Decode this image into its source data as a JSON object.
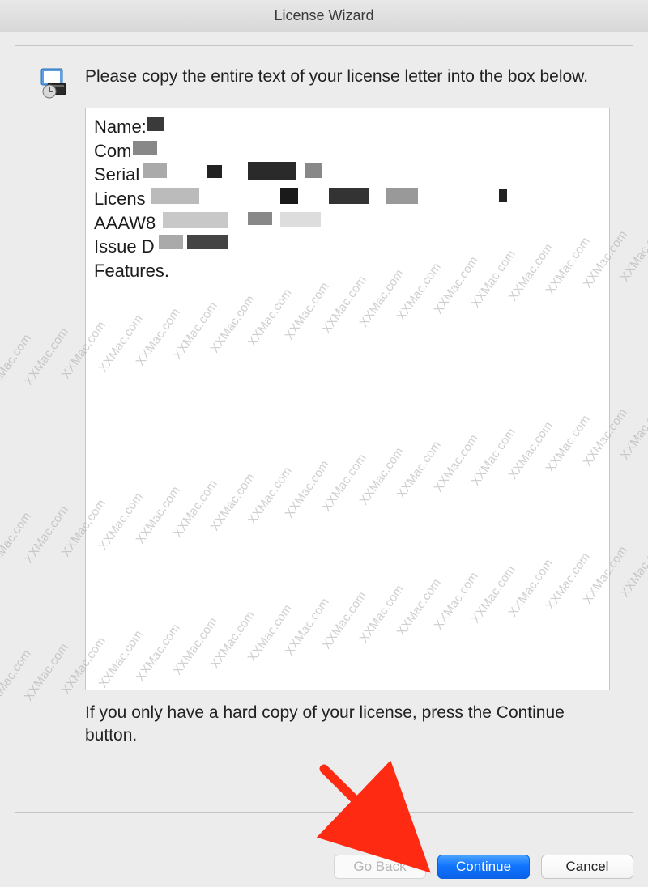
{
  "window": {
    "title": "License Wizard"
  },
  "instruction": "Please copy the entire text of your license letter into the box below.",
  "license_fields": {
    "line1": "Name:",
    "line2": "Com",
    "line3": "Serial",
    "line4": "Licens",
    "line5": "AAAW8",
    "line6": "Issue D",
    "line7": "Features."
  },
  "hint": "If you only have a hard copy of your license, press the Continue button.",
  "buttons": {
    "back": "Go Back",
    "continue": "Continue",
    "cancel": "Cancel"
  },
  "watermark_text": "XXMac.com"
}
